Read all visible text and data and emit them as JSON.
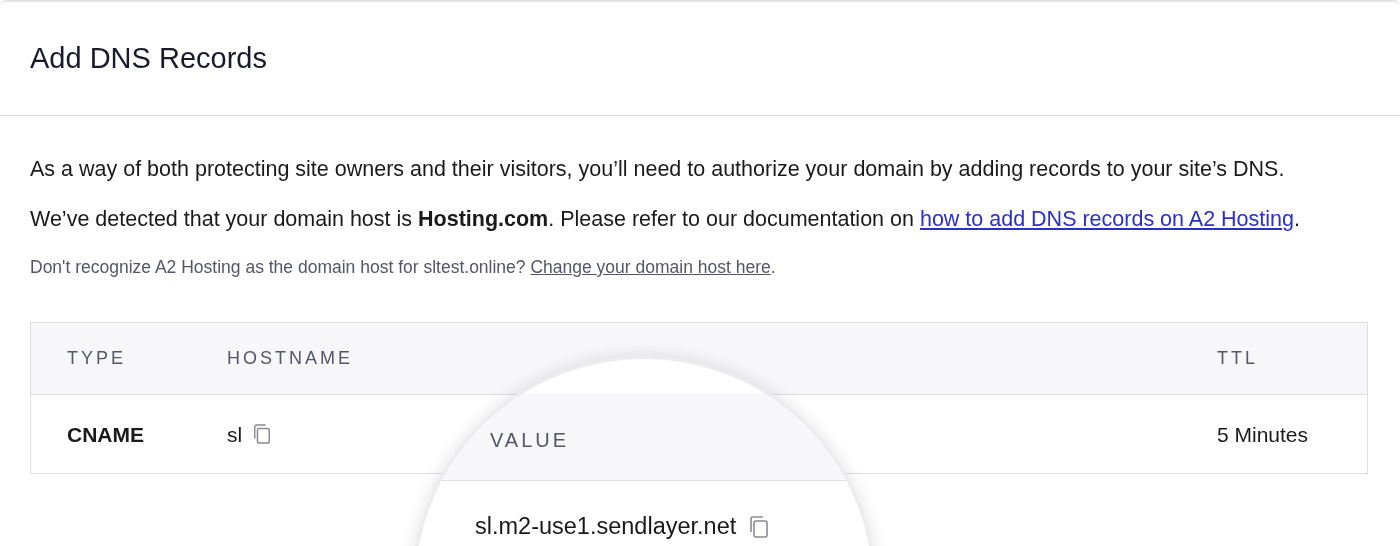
{
  "title": "Add DNS Records",
  "intro": "As a way of both protecting site owners and their visitors, you’ll need to authorize your domain by adding records to your site’s DNS.",
  "detected": {
    "text": "We’ve detected that your domain host is **Hosting.com**. Please refer to our documentation on",
    "link": "how to add DNS records on A2 Hosting",
    "after": "."
  },
  "hint": {
    "text": "Don't recognize A2 Hosting as the domain host for sltest.online?",
    "link": "Change your domain host here",
    "after": "."
  },
  "table": {
    "columns": [
      "TYPE",
      "HOSTNAME",
      "VALUE",
      "TTL"
    ],
    "rows": [
      {
        "type": "CNAME",
        "hostname": "sl",
        "value": "sl.m2-use1.sendlayer.net",
        "ttl": "5 Minutes"
      }
    ]
  }
}
